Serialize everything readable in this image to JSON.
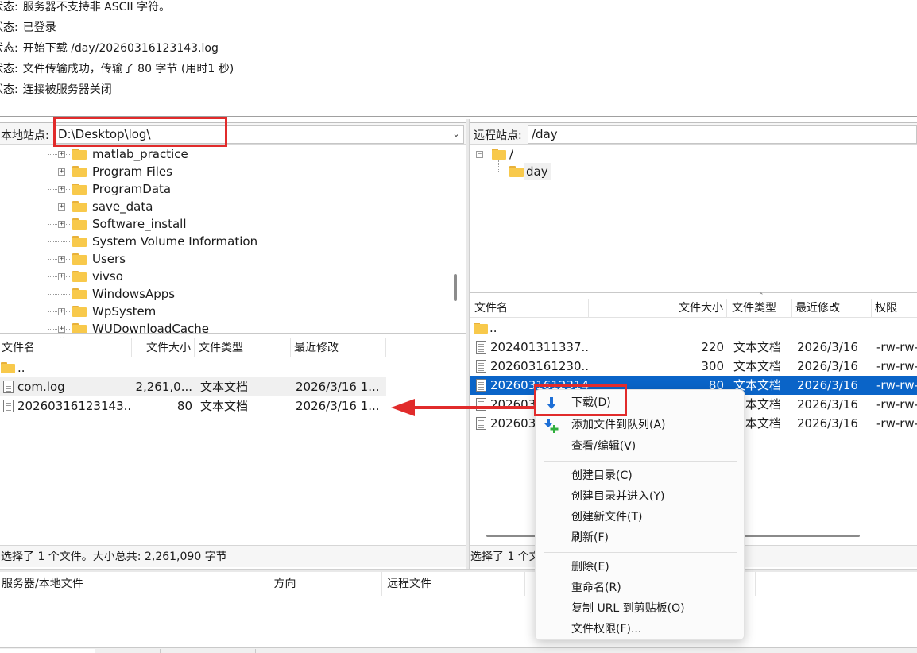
{
  "status_log": [
    {
      "label": "状态:",
      "text": "服务器不支持非 ASCII 字符。"
    },
    {
      "label": "状态:",
      "text": "已登录"
    },
    {
      "label": "状态:",
      "text": "开始下载 /day/20260316123143.log"
    },
    {
      "label": "状态:",
      "text": "文件传输成功，传输了 80 字节 (用时1 秒)"
    },
    {
      "label": "状态:",
      "text": "连接被服务器关闭"
    }
  ],
  "local": {
    "site_label": "本地站点:",
    "path": "D:\\Desktop\\log\\",
    "tree": [
      {
        "name": "matlab_practice",
        "expandable": true
      },
      {
        "name": "Program Files",
        "expandable": true
      },
      {
        "name": "ProgramData",
        "expandable": true
      },
      {
        "name": "save_data",
        "expandable": true
      },
      {
        "name": "Software_install",
        "expandable": true
      },
      {
        "name": "System Volume Information",
        "expandable": false
      },
      {
        "name": "Users",
        "expandable": true
      },
      {
        "name": "vivso",
        "expandable": true
      },
      {
        "name": "WindowsApps",
        "expandable": false
      },
      {
        "name": "WpSystem",
        "expandable": true
      },
      {
        "name": "WUDownloadCache",
        "expandable": true
      }
    ],
    "columns": {
      "name": "文件名",
      "size": "文件大小",
      "type": "文件类型",
      "modified": "最近修改"
    },
    "parent_dir": "..",
    "files": [
      {
        "name": "com.log",
        "size": "2,261,0...",
        "type": "文本文档",
        "modified": "2026/3/16 1..."
      },
      {
        "name": "20260316123143....",
        "size": "80",
        "type": "文本文档",
        "modified": "2026/3/16 1..."
      }
    ],
    "status": "选择了 1 个文件。大小总共: 2,261,090 字节"
  },
  "remote": {
    "site_label": "远程站点:",
    "path": "/day",
    "tree_root": "/",
    "tree_child": "day",
    "columns": {
      "name": "文件名",
      "size": "文件大小",
      "type": "文件类型",
      "modified": "最近修改",
      "perms": "权限"
    },
    "parent_dir": "..",
    "files": [
      {
        "name": "202401311337...",
        "size": "220",
        "type": "文本文档",
        "modified": "2026/3/16",
        "perms": "-rw-rw-"
      },
      {
        "name": "202603161230...",
        "size": "300",
        "type": "文本文档",
        "modified": "2026/3/16",
        "perms": "-rw-rw-"
      },
      {
        "name": "2026031612314...",
        "size": "80",
        "type": "文本文档",
        "modified": "2026/3/16",
        "perms": "-rw-rw-"
      },
      {
        "name": "20260316...",
        "size": "",
        "type": "文本文档",
        "modified": "2026/3/16",
        "perms": "-rw-rw-"
      },
      {
        "name": "20260316...",
        "size": "",
        "type": "文本文档",
        "modified": "2026/3/16",
        "perms": "-rw-rw-"
      }
    ],
    "status": "选择了 1 个文"
  },
  "queue": {
    "columns": {
      "server_local": "服务器/本地文件",
      "direction": "方向",
      "remote_file": "远程文件"
    }
  },
  "context_menu": {
    "items": [
      {
        "id": "download",
        "label": "下载(D)",
        "icon": "download-arrow-icon"
      },
      {
        "id": "add-queue",
        "label": "添加文件到队列(A)",
        "icon": "add-to-queue-icon"
      },
      {
        "id": "view-edit",
        "label": "查看/编辑(V)"
      },
      {
        "id": "mkdir",
        "label": "创建目录(C)"
      },
      {
        "id": "mkdir-enter",
        "label": "创建目录并进入(Y)"
      },
      {
        "id": "new-file",
        "label": "创建新文件(T)"
      },
      {
        "id": "refresh",
        "label": "刷新(F)"
      },
      {
        "id": "delete",
        "label": "删除(E)"
      },
      {
        "id": "rename",
        "label": "重命名(R)"
      },
      {
        "id": "copy-url",
        "label": "复制 URL 到剪贴板(O)"
      },
      {
        "id": "permissions",
        "label": "文件权限(F)..."
      }
    ]
  },
  "colors": {
    "selection": "#0a64c8",
    "annotation_red": "#e12b2b",
    "folder": "#f8c94b",
    "download_icon": "#1d6fd6",
    "add_icon_green": "#2fae3c"
  }
}
